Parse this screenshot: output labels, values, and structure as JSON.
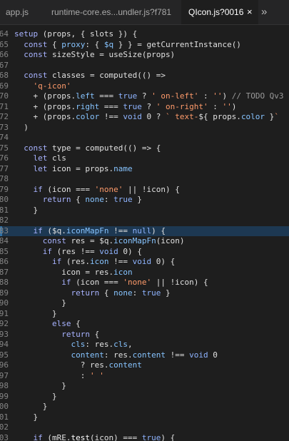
{
  "tabs": [
    {
      "label": "app.js"
    },
    {
      "label": "runtime-core.es...undler.js?f781"
    },
    {
      "label": "QIcon.js?0016",
      "active": true
    }
  ],
  "tab_close_glyph": "×",
  "overflow_glyph": "»",
  "active_line": 83,
  "lines": [
    {
      "n": "64",
      "t": [
        [
          "kw",
          "setup"
        ],
        [
          "op",
          " (props, { slots }) {"
        ]
      ]
    },
    {
      "n": "65",
      "t": [
        [
          "op",
          "  "
        ],
        [
          "kw",
          "const"
        ],
        [
          "op",
          " { "
        ],
        [
          "prop",
          "proxy"
        ],
        [
          "op",
          ": { "
        ],
        [
          "prop",
          "$q"
        ],
        [
          "op",
          " } } = getCurrentInstance()"
        ]
      ]
    },
    {
      "n": "66",
      "t": [
        [
          "op",
          "  "
        ],
        [
          "kw",
          "const"
        ],
        [
          "op",
          " sizeStyle = useSize(props)"
        ]
      ]
    },
    {
      "n": "67",
      "t": []
    },
    {
      "n": "68",
      "t": [
        [
          "op",
          "  "
        ],
        [
          "kw",
          "const"
        ],
        [
          "op",
          " classes = computed(() =>"
        ]
      ]
    },
    {
      "n": "69",
      "t": [
        [
          "op",
          "    "
        ],
        [
          "str",
          "'q-icon'"
        ]
      ]
    },
    {
      "n": "70",
      "t": [
        [
          "op",
          "    + (props."
        ],
        [
          "prop",
          "left"
        ],
        [
          "op",
          " === "
        ],
        [
          "bool",
          "true"
        ],
        [
          "op",
          " ? "
        ],
        [
          "str",
          "' on-left'"
        ],
        [
          "op",
          " : "
        ],
        [
          "str",
          "''"
        ],
        [
          "op",
          ") "
        ],
        [
          "cmt",
          "// TODO Qv3"
        ]
      ]
    },
    {
      "n": "71",
      "t": [
        [
          "op",
          "    + (props."
        ],
        [
          "prop",
          "right"
        ],
        [
          "op",
          " === "
        ],
        [
          "bool",
          "true"
        ],
        [
          "op",
          " ? "
        ],
        [
          "str",
          "' on-right'"
        ],
        [
          "op",
          " : "
        ],
        [
          "str",
          "''"
        ],
        [
          "op",
          ")"
        ]
      ]
    },
    {
      "n": "72",
      "t": [
        [
          "op",
          "    + (props."
        ],
        [
          "prop",
          "color"
        ],
        [
          "op",
          " !== "
        ],
        [
          "bool",
          "void"
        ],
        [
          "op",
          " 0 ? "
        ],
        [
          "str",
          "` text-"
        ],
        [
          "op",
          "${ props."
        ],
        [
          "prop",
          "color"
        ],
        [
          "op",
          " }"
        ],
        [
          "str",
          "`"
        ]
      ]
    },
    {
      "n": "73",
      "t": [
        [
          "op",
          "  )"
        ]
      ]
    },
    {
      "n": "74",
      "t": []
    },
    {
      "n": "75",
      "t": [
        [
          "op",
          "  "
        ],
        [
          "kw",
          "const"
        ],
        [
          "op",
          " type = computed(() => {"
        ]
      ]
    },
    {
      "n": "76",
      "t": [
        [
          "op",
          "    "
        ],
        [
          "kw",
          "let"
        ],
        [
          "op",
          " cls"
        ]
      ]
    },
    {
      "n": "77",
      "t": [
        [
          "op",
          "    "
        ],
        [
          "kw",
          "let"
        ],
        [
          "op",
          " icon = props."
        ],
        [
          "prop",
          "name"
        ]
      ]
    },
    {
      "n": "78",
      "t": []
    },
    {
      "n": "79",
      "t": [
        [
          "op",
          "    "
        ],
        [
          "kw",
          "if"
        ],
        [
          "op",
          " (icon === "
        ],
        [
          "str",
          "'none'"
        ],
        [
          "op",
          " || !icon) {"
        ]
      ]
    },
    {
      "n": "80",
      "t": [
        [
          "op",
          "      "
        ],
        [
          "kw",
          "return"
        ],
        [
          "op",
          " { "
        ],
        [
          "prop",
          "none"
        ],
        [
          "op",
          ": "
        ],
        [
          "bool",
          "true"
        ],
        [
          "op",
          " }"
        ]
      ]
    },
    {
      "n": "81",
      "t": [
        [
          "op",
          "    }"
        ]
      ]
    },
    {
      "n": "82",
      "t": []
    },
    {
      "n": "83",
      "t": [
        [
          "op",
          "    "
        ],
        [
          "kw",
          "if"
        ],
        [
          "op",
          " ($q."
        ],
        [
          "prop",
          "iconMapFn"
        ],
        [
          "op",
          " !== "
        ],
        [
          "bool",
          "null"
        ],
        [
          "op",
          ") {"
        ]
      ]
    },
    {
      "n": "84",
      "t": [
        [
          "op",
          "      "
        ],
        [
          "kw",
          "const"
        ],
        [
          "op",
          " res = $q."
        ],
        [
          "prop",
          "iconMapFn"
        ],
        [
          "op",
          "(icon)"
        ]
      ]
    },
    {
      "n": "85",
      "t": [
        [
          "op",
          "      "
        ],
        [
          "kw",
          "if"
        ],
        [
          "op",
          " (res !== "
        ],
        [
          "bool",
          "void"
        ],
        [
          "op",
          " 0) {"
        ]
      ]
    },
    {
      "n": "86",
      "t": [
        [
          "op",
          "        "
        ],
        [
          "kw",
          "if"
        ],
        [
          "op",
          " (res."
        ],
        [
          "prop",
          "icon"
        ],
        [
          "op",
          " !== "
        ],
        [
          "bool",
          "void"
        ],
        [
          "op",
          " 0) {"
        ]
      ]
    },
    {
      "n": "87",
      "t": [
        [
          "op",
          "          icon = res."
        ],
        [
          "prop",
          "icon"
        ]
      ]
    },
    {
      "n": "88",
      "t": [
        [
          "op",
          "          "
        ],
        [
          "kw",
          "if"
        ],
        [
          "op",
          " (icon === "
        ],
        [
          "str",
          "'none'"
        ],
        [
          "op",
          " || !icon) {"
        ]
      ]
    },
    {
      "n": "89",
      "t": [
        [
          "op",
          "            "
        ],
        [
          "kw",
          "return"
        ],
        [
          "op",
          " { "
        ],
        [
          "prop",
          "none"
        ],
        [
          "op",
          ": "
        ],
        [
          "bool",
          "true"
        ],
        [
          "op",
          " }"
        ]
      ]
    },
    {
      "n": "90",
      "t": [
        [
          "op",
          "          }"
        ]
      ]
    },
    {
      "n": "91",
      "t": [
        [
          "op",
          "        }"
        ]
      ]
    },
    {
      "n": "92",
      "t": [
        [
          "op",
          "        "
        ],
        [
          "kw",
          "else"
        ],
        [
          "op",
          " {"
        ]
      ]
    },
    {
      "n": "93",
      "t": [
        [
          "op",
          "          "
        ],
        [
          "kw",
          "return"
        ],
        [
          "op",
          " {"
        ]
      ]
    },
    {
      "n": "94",
      "t": [
        [
          "op",
          "            "
        ],
        [
          "prop",
          "cls"
        ],
        [
          "op",
          ": res."
        ],
        [
          "prop",
          "cls"
        ],
        [
          "op",
          ","
        ]
      ]
    },
    {
      "n": "95",
      "t": [
        [
          "op",
          "            "
        ],
        [
          "prop",
          "content"
        ],
        [
          "op",
          ": res."
        ],
        [
          "prop",
          "content"
        ],
        [
          "op",
          " !== "
        ],
        [
          "bool",
          "void"
        ],
        [
          "op",
          " 0"
        ]
      ]
    },
    {
      "n": "96",
      "t": [
        [
          "op",
          "              ? res."
        ],
        [
          "prop",
          "content"
        ]
      ]
    },
    {
      "n": "97",
      "t": [
        [
          "op",
          "              : "
        ],
        [
          "str",
          "' '"
        ]
      ]
    },
    {
      "n": "98",
      "t": [
        [
          "op",
          "          }"
        ]
      ]
    },
    {
      "n": "99",
      "t": [
        [
          "op",
          "        }"
        ]
      ]
    },
    {
      "n": "00",
      "t": [
        [
          "op",
          "      }"
        ]
      ]
    },
    {
      "n": "01",
      "t": [
        [
          "op",
          "    }"
        ]
      ]
    },
    {
      "n": "02",
      "t": []
    },
    {
      "n": "03",
      "t": [
        [
          "op",
          "    "
        ],
        [
          "kw",
          "if"
        ],
        [
          "op",
          " (mRE."
        ],
        [
          "fn",
          "test"
        ],
        [
          "op",
          "(icon) === "
        ],
        [
          "bool",
          "true"
        ],
        [
          "op",
          ") {"
        ]
      ]
    }
  ],
  "colors": {
    "background": "#1e1e1e",
    "keyword": "#a8b3ff",
    "string": "#ff9b6b",
    "literal": "#8fb4ff",
    "property": "#87c4ff",
    "comment": "#9a9a9a",
    "active_line": "#1d3852"
  }
}
